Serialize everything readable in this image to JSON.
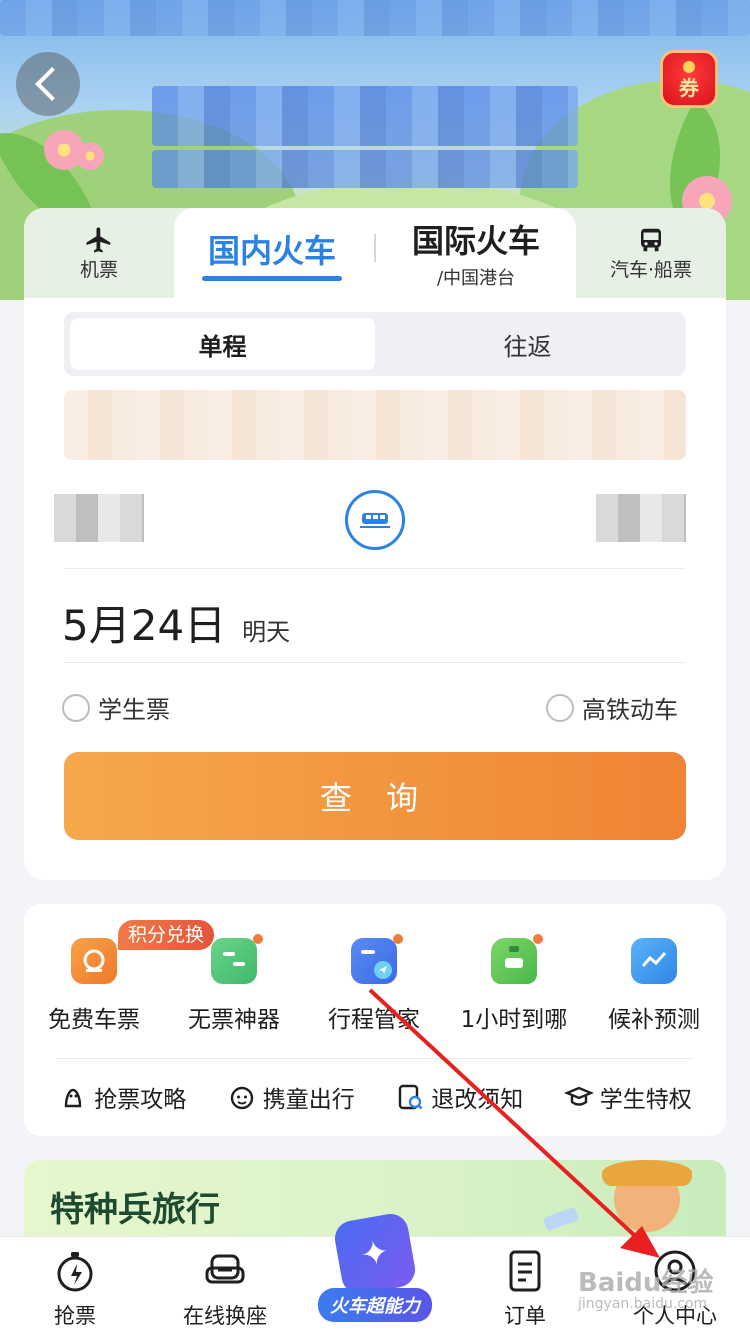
{
  "header": {
    "coupon_label": "券"
  },
  "tabs": {
    "plane_label": "机票",
    "domestic_label": "国内火车",
    "international_label": "国际火车",
    "international_sub": "/中国港台",
    "bus_label": "汽车·船票"
  },
  "trip": {
    "one_way": "单程",
    "round_trip": "往返"
  },
  "date": {
    "value": "5月24日",
    "relative": "明天"
  },
  "options": {
    "student": "学生票",
    "high_speed": "高铁动车"
  },
  "search_button": "查 询",
  "services": {
    "badge": "积分兑换",
    "items": [
      {
        "label": "免费车票",
        "icon": "free-ticket-icon"
      },
      {
        "label": "无票神器",
        "icon": "no-ticket-tool-icon"
      },
      {
        "label": "行程管家",
        "icon": "trip-manager-icon"
      },
      {
        "label": "1小时到哪",
        "icon": "one-hour-trip-icon"
      },
      {
        "label": "候补预测",
        "icon": "waitlist-forecast-icon"
      }
    ],
    "guides": [
      {
        "label": "抢票攻略",
        "icon": "ticket-guide-icon"
      },
      {
        "label": "携童出行",
        "icon": "child-travel-icon"
      },
      {
        "label": "退改须知",
        "icon": "refund-notice-icon"
      },
      {
        "label": "学生特权",
        "icon": "student-privilege-icon"
      }
    ]
  },
  "banner": {
    "title": "特种兵旅行"
  },
  "nav": {
    "items": [
      {
        "label": "抢票",
        "icon": "stopwatch-icon"
      },
      {
        "label": "在线换座",
        "icon": "seat-icon"
      },
      {
        "label": "火车超能力",
        "icon": "super-power-icon"
      },
      {
        "label": "订单",
        "icon": "order-icon"
      },
      {
        "label": "个人中心",
        "icon": "profile-icon"
      }
    ]
  },
  "colors": {
    "accent": "#2a82e4",
    "search_start": "#f5a84a",
    "search_end": "#f08434",
    "annotation_arrow": "#e8201f"
  },
  "watermark": {
    "text": "Baidu经验",
    "sub": "jingyan.baidu.com"
  }
}
